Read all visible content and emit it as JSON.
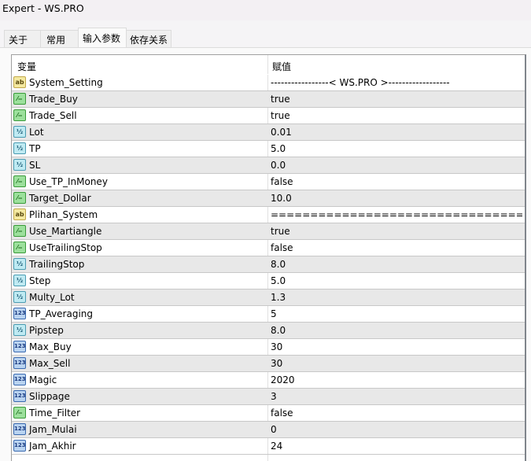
{
  "window": {
    "title": "Expert - WS.PRO"
  },
  "tabs": [
    {
      "label": "关于"
    },
    {
      "label": "常用"
    },
    {
      "label": "输入参数",
      "active": true
    },
    {
      "label": "依存关系"
    }
  ],
  "table": {
    "headers": {
      "variable": "变量",
      "value": "赋值"
    },
    "rows": [
      {
        "type": "ab",
        "icon": "string-icon",
        "name": "System_Setting",
        "value": "-----------------< WS.PRO  >------------------"
      },
      {
        "type": "bool",
        "icon": "bool-icon",
        "name": "Trade_Buy",
        "value": "true"
      },
      {
        "type": "bool",
        "icon": "bool-icon",
        "name": "Trade_Sell",
        "value": "true"
      },
      {
        "type": "dbl",
        "icon": "double-icon",
        "name": "Lot",
        "value": "0.01"
      },
      {
        "type": "dbl",
        "icon": "double-icon",
        "name": "TP",
        "value": "5.0"
      },
      {
        "type": "dbl",
        "icon": "double-icon",
        "name": "SL",
        "value": "0.0"
      },
      {
        "type": "bool",
        "icon": "bool-icon",
        "name": "Use_TP_InMoney",
        "value": "false"
      },
      {
        "type": "bool",
        "icon": "bool-icon",
        "name": "Target_Dollar",
        "value": "10.0"
      },
      {
        "type": "ab",
        "icon": "string-icon",
        "name": "Plihan_System",
        "value": "=========================================..."
      },
      {
        "type": "bool",
        "icon": "bool-icon",
        "name": "Use_Martiangle",
        "value": "true"
      },
      {
        "type": "bool",
        "icon": "bool-icon",
        "name": "UseTrailingStop",
        "value": "false"
      },
      {
        "type": "dbl",
        "icon": "double-icon",
        "name": "TrailingStop",
        "value": "8.0"
      },
      {
        "type": "dbl",
        "icon": "double-icon",
        "name": "Step",
        "value": "5.0"
      },
      {
        "type": "dbl",
        "icon": "double-icon",
        "name": "Multy_Lot",
        "value": "1.3"
      },
      {
        "type": "int",
        "icon": "integer-icon",
        "name": "TP_Averaging",
        "value": "5"
      },
      {
        "type": "dbl",
        "icon": "double-icon",
        "name": "Pipstep",
        "value": "8.0"
      },
      {
        "type": "int",
        "icon": "integer-icon",
        "name": "Max_Buy",
        "value": "30"
      },
      {
        "type": "int",
        "icon": "integer-icon",
        "name": "Max_Sell",
        "value": "30"
      },
      {
        "type": "int",
        "icon": "integer-icon",
        "name": "Magic",
        "value": "2020"
      },
      {
        "type": "int",
        "icon": "integer-icon",
        "name": "Slippage",
        "value": "3"
      },
      {
        "type": "bool",
        "icon": "bool-icon",
        "name": "Time_Filter",
        "value": "false"
      },
      {
        "type": "int",
        "icon": "integer-icon",
        "name": "Jam_Mulai",
        "value": "0"
      },
      {
        "type": "int",
        "icon": "integer-icon",
        "name": "Jam_Akhir",
        "value": "24"
      }
    ]
  }
}
